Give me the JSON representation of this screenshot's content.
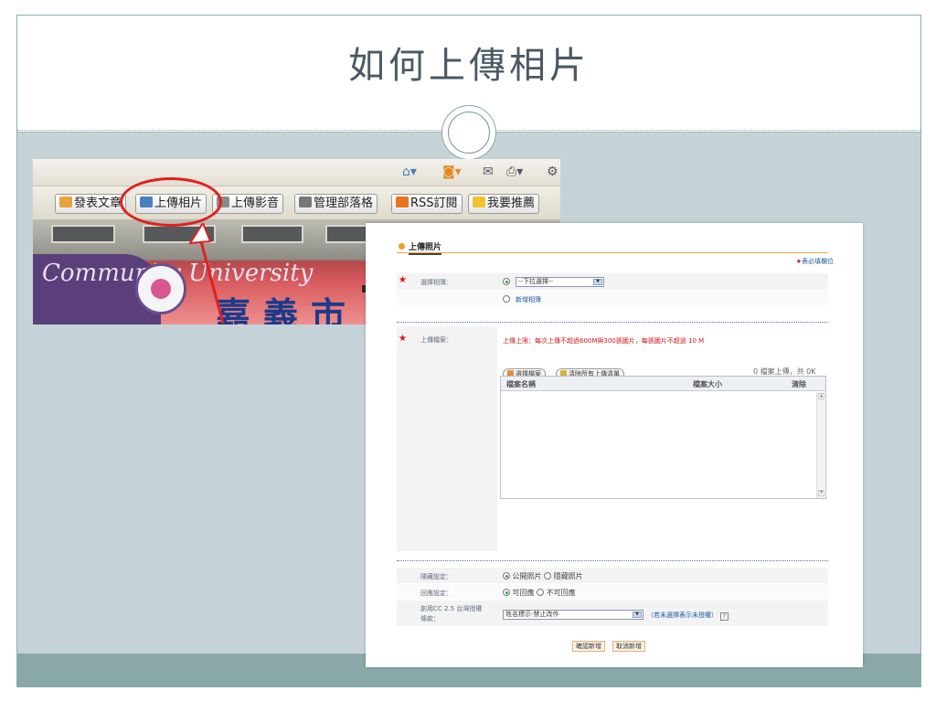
{
  "slide": {
    "title": "如何上傳相片"
  },
  "browser_toolbar": {
    "buttons": [
      {
        "label": "發表文章",
        "icon": "compose-icon"
      },
      {
        "label": "上傳相片",
        "icon": "photo-icon"
      },
      {
        "label": "上傳影音",
        "icon": "video-icon"
      },
      {
        "label": "管理部落格",
        "icon": "manage-icon"
      },
      {
        "label": "RSS訂閱",
        "icon": "rss-icon"
      },
      {
        "label": "我要推薦",
        "icon": "star-icon"
      }
    ],
    "top_icons": [
      "home-icon",
      "feed-icon",
      "mail-icon",
      "print-icon"
    ]
  },
  "banner": {
    "script_text": "Community University",
    "sign_text": "嘉義市"
  },
  "form": {
    "heading": "上傳照片",
    "required_note_star": "★",
    "required_note": "表必填欄位",
    "album": {
      "label": "選擇相簿：",
      "select_value": "--下拉選擇--",
      "new_album": "新增相簿"
    },
    "upload": {
      "label": "上傳檔案：",
      "limit_text": "上傳上限：每次上傳不超過600M與300張圖片，每張圖片不超過 10 M",
      "choose_button": "選擇檔案",
      "clear_button": "清除所有上傳清單",
      "status": "0 檔案上傳，共 0K",
      "columns": [
        "檔案名稱",
        "檔案大小",
        "清除"
      ]
    },
    "privacy": {
      "label": "隱藏設定：",
      "options": [
        "公開照片",
        "隱藏照片"
      ],
      "selected": "公開照片"
    },
    "reply": {
      "label": "回應設定：",
      "options": [
        "可回應",
        "不可回應"
      ],
      "selected": "可回應"
    },
    "license": {
      "label_line1": "創用CC 2.5 台灣授權",
      "label_line2": "條款：",
      "select_value": "姓名標示-禁止改作",
      "note": "（若未選擇表示未授權）",
      "help": "?"
    },
    "submit_button": "確認新增",
    "cancel_button": "取消新增"
  },
  "colors": {
    "accent_red": "#e0201e",
    "band": "#8aa8a8",
    "body": "#c5d3d9",
    "form_orange": "#f39a2a"
  }
}
